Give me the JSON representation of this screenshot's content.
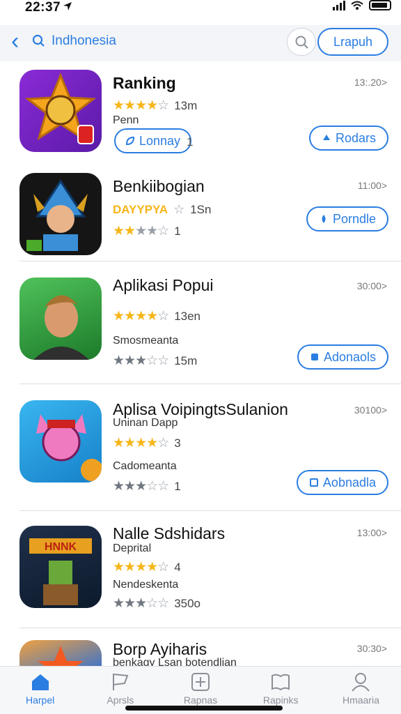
{
  "status": {
    "time": "22:37"
  },
  "header": {
    "title": "Indhonesia",
    "pill_label": "Lrapuh"
  },
  "apps": [
    {
      "title": "Ranking",
      "time": "13:.20>",
      "rating": 4.5,
      "count": "13m",
      "subtitle": "Penn",
      "button": "Rodars",
      "secondary_button": "Lonnay",
      "secondary_num": "1"
    },
    {
      "title": "Benkiibogian",
      "time": "11:00>",
      "brand_text": "DAYYPYA",
      "count": "1Sn",
      "rating2": 3.5,
      "count2": "1",
      "button": "Porndle"
    },
    {
      "title": "Aplikasi Popui",
      "time": "30:00>",
      "rating": 4.5,
      "count": "13en",
      "subtitle": "Smosmeanta",
      "rating2": 3.5,
      "count2": "15m",
      "button": "Adonaols"
    },
    {
      "title": "Aplisa VoipingtsSulanion",
      "time": "30100>",
      "subtitle": "Uninan Dapp",
      "rating": 4,
      "count": "3",
      "subtitle2": "Cadomeanta",
      "rating2": 3.5,
      "count2": "1",
      "button": "Aobnadla"
    },
    {
      "title": "Nalle Sdshidars",
      "time": "13:00>",
      "subtitle": "Deprital",
      "rating": 4,
      "count": "4",
      "subtitle2": "Nendeskenta",
      "rating2": 3.5,
      "count2": "350o"
    },
    {
      "title": "Borp Ayiharis",
      "time": "30:30>",
      "subtitle": "benkagy Lsan botendlian"
    }
  ],
  "icon_badges": {
    "app1": "...",
    "app5_banner": "HNNK"
  },
  "tabs": [
    {
      "label": "Harpel",
      "icon": "home-icon",
      "active": true
    },
    {
      "label": "Aprsls",
      "icon": "flag-icon",
      "active": false
    },
    {
      "label": "Rapnas",
      "icon": "plus-box-icon",
      "active": false
    },
    {
      "label": "Rapinks",
      "icon": "book-icon",
      "active": false
    },
    {
      "label": "Hmaaria",
      "icon": "person-icon",
      "active": false
    }
  ],
  "colors": {
    "accent": "#2a7de1",
    "star": "#f6b619"
  }
}
